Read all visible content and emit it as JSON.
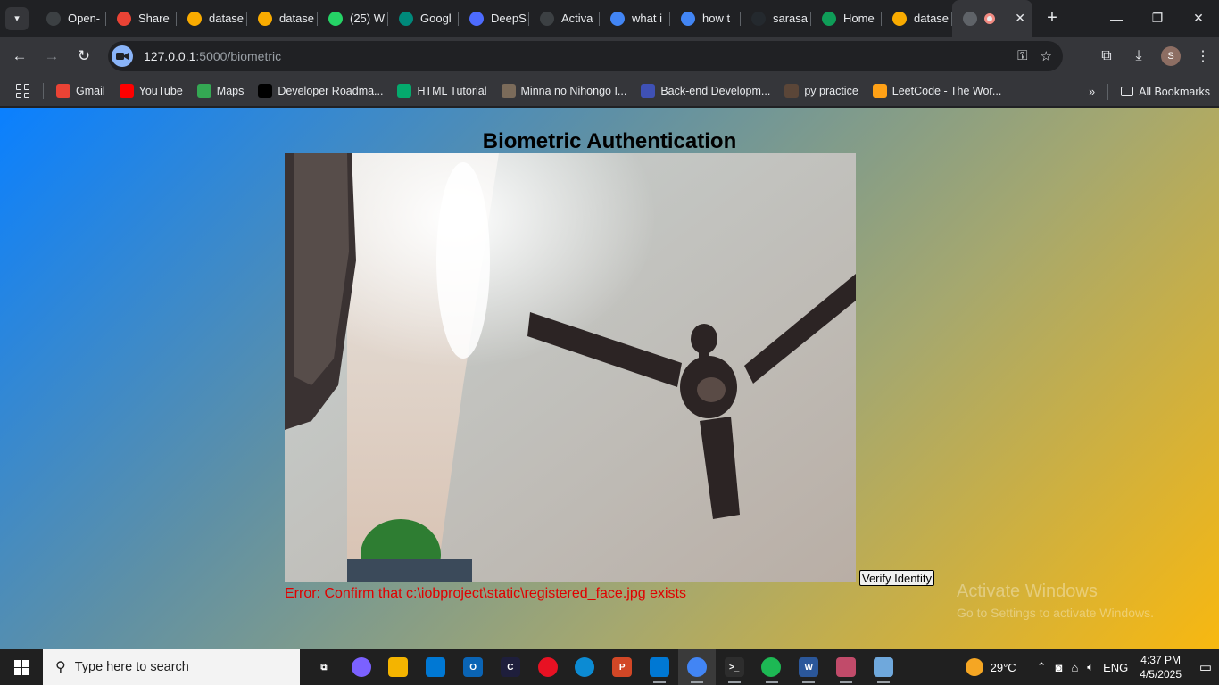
{
  "browser": {
    "tabs": [
      {
        "label": "Open-",
        "icon": "openai-icon",
        "color": "#3c4043"
      },
      {
        "label": "Share",
        "icon": "gmail-icon",
        "color": "#ea4335"
      },
      {
        "label": "datase",
        "icon": "colab-icon",
        "color": "#f9ab00"
      },
      {
        "label": "datase",
        "icon": "colab-icon",
        "color": "#f9ab00"
      },
      {
        "label": "(25) W",
        "icon": "whatsapp-icon",
        "color": "#25d366"
      },
      {
        "label": "Googl",
        "icon": "google-meet-icon",
        "color": "#00897b"
      },
      {
        "label": "DeepS",
        "icon": "deepseek-icon",
        "color": "#4d6bfe"
      },
      {
        "label": "Activa",
        "icon": "openai-icon",
        "color": "#3c4043"
      },
      {
        "label": "what i",
        "icon": "google-icon",
        "color": "#4285f4"
      },
      {
        "label": "how t",
        "icon": "google-icon",
        "color": "#4285f4"
      },
      {
        "label": "sarasa",
        "icon": "github-icon",
        "color": "#24292e"
      },
      {
        "label": "Home",
        "icon": "google-drive-icon",
        "color": "#0f9d58"
      },
      {
        "label": "datase",
        "icon": "colab-icon",
        "color": "#f9ab00"
      }
    ],
    "url_host": "127.0.0.1",
    "url_path": ":5000/biometric",
    "profile_initial": "S",
    "bookmarks": [
      {
        "label": "Gmail",
        "icon": "gmail-icon",
        "color": "#ea4335"
      },
      {
        "label": "YouTube",
        "icon": "youtube-icon",
        "color": "#ff0000"
      },
      {
        "label": "Maps",
        "icon": "maps-icon",
        "color": "#34a853"
      },
      {
        "label": "Developer Roadma...",
        "icon": "roadmap-icon",
        "color": "#000000"
      },
      {
        "label": "HTML Tutorial",
        "icon": "w3schools-icon",
        "color": "#04aa6d"
      },
      {
        "label": "Minna no Nihongo I...",
        "icon": "book-icon",
        "color": "#7b6b5a"
      },
      {
        "label": "Back-end Developm...",
        "icon": "cloud-icon",
        "color": "#3f51b5"
      },
      {
        "label": "py practice",
        "icon": "codechef-icon",
        "color": "#5b4638"
      },
      {
        "label": "LeetCode - The Wor...",
        "icon": "leetcode-icon",
        "color": "#ffa116"
      }
    ],
    "all_bookmarks_label": "All Bookmarks"
  },
  "page": {
    "title": "Biometric Authentication",
    "verify_button": "Verify Identity",
    "error": "Error: Confirm that c:\\iobproject\\static\\registered_face.jpg exists"
  },
  "watermark": {
    "line1": "Activate Windows",
    "line2": "Go to Settings to activate Windows."
  },
  "taskbar": {
    "search_placeholder": "Type here to search",
    "weather_temp": "29°C",
    "language": "ENG",
    "time": "4:37 PM",
    "date": "4/5/2025",
    "apps": [
      {
        "name": "task-view-icon",
        "color": "#202020",
        "glyph": "⧉"
      },
      {
        "name": "copilot-icon",
        "color": "#7b61ff",
        "glyph": ""
      },
      {
        "name": "file-explorer-icon",
        "color": "#f4b400",
        "glyph": ""
      },
      {
        "name": "microsoft-store-icon",
        "color": "#0078d4",
        "glyph": ""
      },
      {
        "name": "outlook-icon",
        "color": "#0a64b5",
        "glyph": "O"
      },
      {
        "name": "ide-icon",
        "color": "#1e1e3c",
        "glyph": "C"
      },
      {
        "name": "recorder-icon",
        "color": "#e81123",
        "glyph": ""
      },
      {
        "name": "edge-icon",
        "color": "#0c8bd3",
        "glyph": ""
      },
      {
        "name": "powerpoint-icon",
        "color": "#d24726",
        "glyph": "P"
      },
      {
        "name": "vscode-icon",
        "color": "#0078d4",
        "glyph": ""
      },
      {
        "name": "chrome-icon",
        "color": "#4285f4",
        "glyph": ""
      },
      {
        "name": "terminal-icon",
        "color": "#2d2d2d",
        "glyph": ">_"
      },
      {
        "name": "spotify-icon",
        "color": "#1db954",
        "glyph": ""
      },
      {
        "name": "word-icon",
        "color": "#2b579a",
        "glyph": "W"
      },
      {
        "name": "snipping-tool-icon",
        "color": "#c14b6a",
        "glyph": ""
      },
      {
        "name": "notepad-icon",
        "color": "#6fa8dc",
        "glyph": ""
      }
    ]
  }
}
